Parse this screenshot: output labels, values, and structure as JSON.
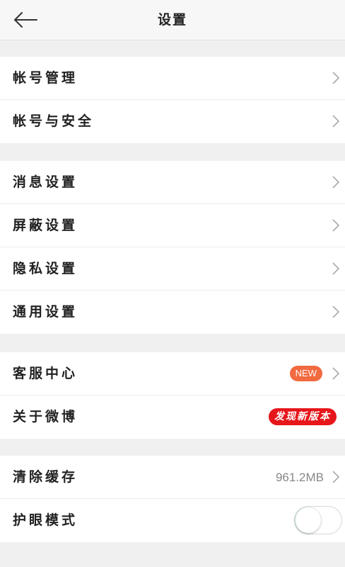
{
  "header": {
    "title": "设置",
    "back_icon": "arrow-left-icon"
  },
  "groups": [
    {
      "items": [
        {
          "label": "帐号管理",
          "icon": "chevron-right-icon"
        },
        {
          "label": "帐号与安全",
          "icon": "chevron-right-icon"
        }
      ]
    },
    {
      "items": [
        {
          "label": "消息设置",
          "icon": "chevron-right-icon"
        },
        {
          "label": "屏蔽设置",
          "icon": "chevron-right-icon"
        },
        {
          "label": "隐私设置",
          "icon": "chevron-right-icon"
        },
        {
          "label": "通用设置",
          "icon": "chevron-right-icon"
        }
      ]
    },
    {
      "items": [
        {
          "label": "客服中心",
          "badge": "NEW",
          "icon": "chevron-right-icon"
        },
        {
          "label": "关于微博",
          "badge": "发现新版本"
        }
      ]
    },
    {
      "items": [
        {
          "label": "清除缓存",
          "value": "961.2MB",
          "icon": "chevron-right-icon"
        },
        {
          "label": "护眼模式",
          "toggle": false
        }
      ]
    }
  ],
  "colors": {
    "new_badge": "#f26a3f",
    "version_badge": "#e6161b",
    "background": "#f0f0f0"
  }
}
